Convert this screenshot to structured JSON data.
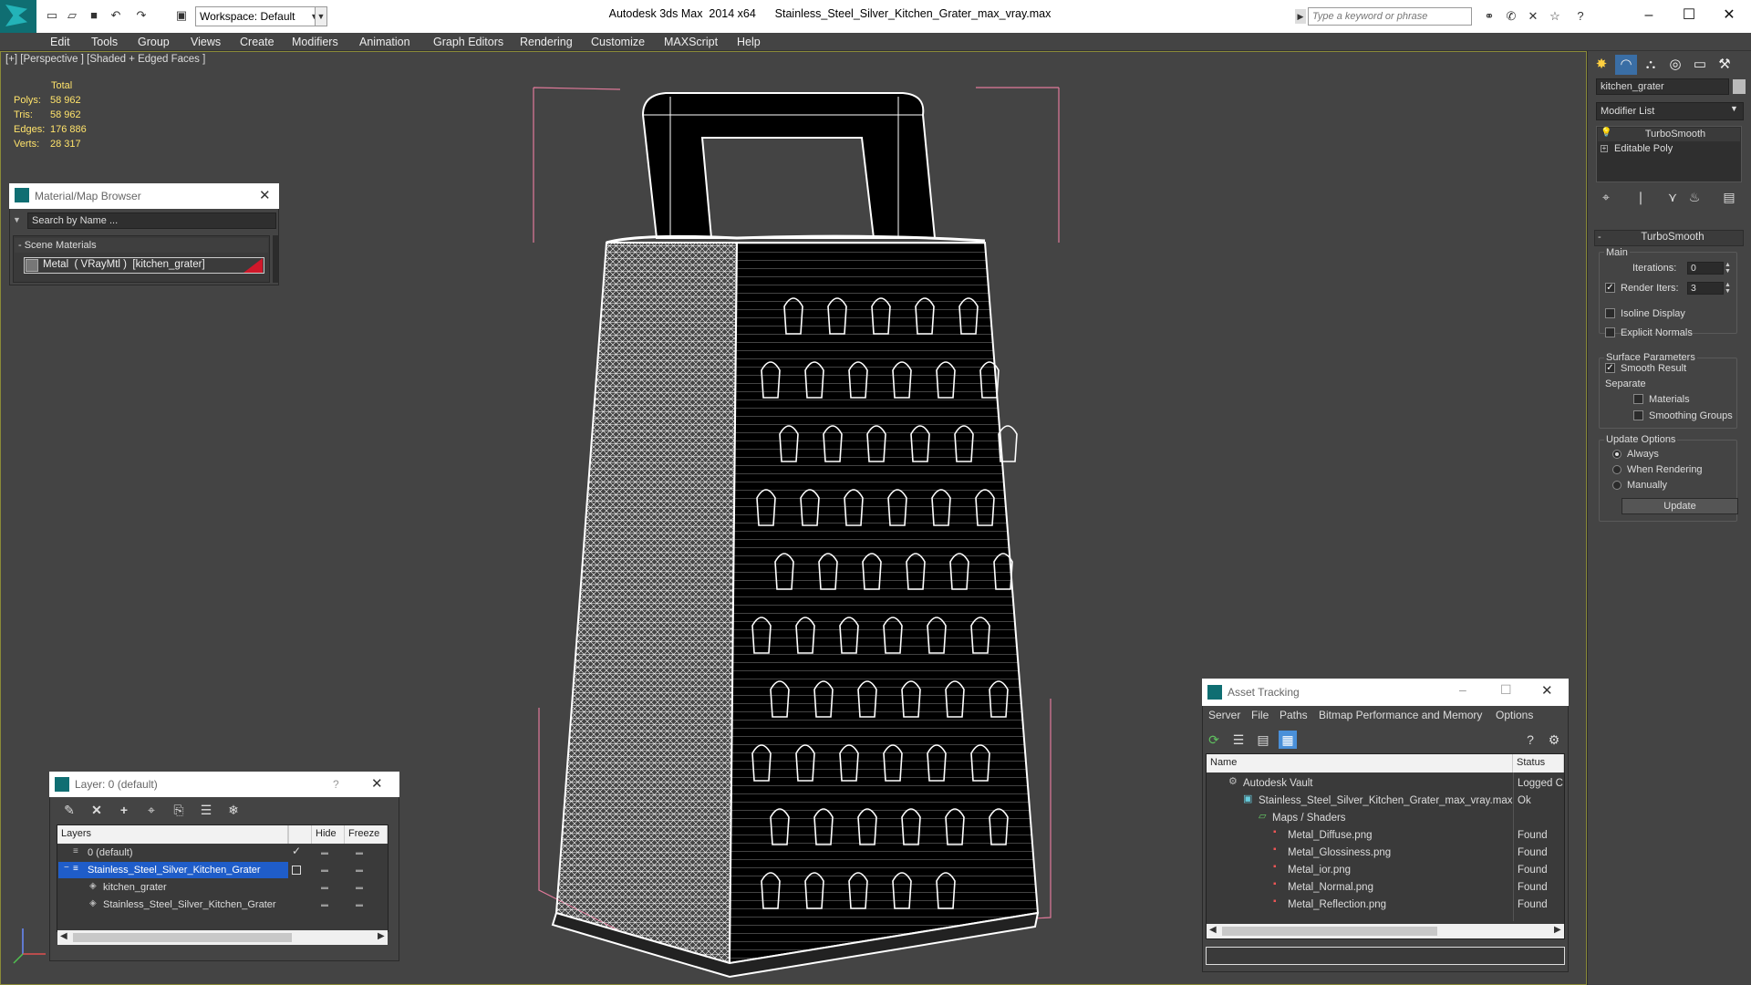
{
  "titlebar": {
    "workspace_label": "Workspace: Default",
    "app_title": "Autodesk 3ds Max  2014 x64      Stainless_Steel_Silver_Kitchen_Grater_max_vray.max",
    "search_placeholder": "Type a keyword or phrase"
  },
  "menu": [
    "Edit",
    "Tools",
    "Group",
    "Views",
    "Create",
    "Modifiers",
    "Animation",
    "Graph Editors",
    "Rendering",
    "Customize",
    "MAXScript",
    "Help"
  ],
  "viewport": {
    "label": "[+] [Perspective ] [Shaded + Edged Faces ]",
    "stats": {
      "total_label": "Total",
      "rows": [
        {
          "label": "Polys:",
          "value": "58 962"
        },
        {
          "label": "Tris:",
          "value": "58 962"
        },
        {
          "label": "Edges:",
          "value": "176 886"
        },
        {
          "label": "Verts:",
          "value": "28 317"
        }
      ]
    }
  },
  "material_browser": {
    "title": "Material/Map Browser",
    "search_placeholder": "Search by Name ...",
    "section": "- Scene Materials",
    "item": "Metal  ( VRayMtl )  [kitchen_grater]"
  },
  "layer_panel": {
    "title": "Layer: 0 (default)",
    "help": "?",
    "columns": {
      "layers": "Layers",
      "hide": "Hide",
      "freeze": "Freeze"
    },
    "rows": [
      {
        "name": "0 (default)"
      },
      {
        "name": "Stainless_Steel_Silver_Kitchen_Grater"
      },
      {
        "name": "kitchen_grater"
      },
      {
        "name": "Stainless_Steel_Silver_Kitchen_Grater"
      }
    ]
  },
  "asset_tracking": {
    "title": "Asset Tracking",
    "menu": [
      "Server",
      "File",
      "Paths",
      "Bitmap Performance and Memory",
      "Options"
    ],
    "columns": {
      "name": "Name",
      "status": "Status"
    },
    "rows": [
      {
        "name": "Autodesk Vault",
        "status": "Logged C"
      },
      {
        "name": "Stainless_Steel_Silver_Kitchen_Grater_max_vray.max",
        "status": "Ok"
      },
      {
        "name": "Maps / Shaders",
        "status": ""
      },
      {
        "name": "Metal_Diffuse.png",
        "status": "Found"
      },
      {
        "name": "Metal_Glossiness.png",
        "status": "Found"
      },
      {
        "name": "Metal_ior.png",
        "status": "Found"
      },
      {
        "name": "Metal_Normal.png",
        "status": "Found"
      },
      {
        "name": "Metal_Reflection.png",
        "status": "Found"
      }
    ]
  },
  "command_panel": {
    "object_name": "kitchen_grater",
    "modifier_list": "Modifier List",
    "stack": [
      "TurboSmooth",
      "Editable Poly"
    ],
    "rollout": "TurboSmooth",
    "main_label": "Main",
    "iterations_label": "Iterations:",
    "iterations_value": "0",
    "render_iters_label": "Render Iters:",
    "render_iters_value": "3",
    "isoline_label": "Isoline Display",
    "explicit_label": "Explicit Normals",
    "surface_label": "Surface Parameters",
    "smooth_label": "Smooth Result",
    "separate_label": "Separate",
    "materials_label": "Materials",
    "smoothing_groups_label": "Smoothing Groups",
    "update_options_label": "Update Options",
    "always_label": "Always",
    "when_rendering_label": "When Rendering",
    "manually_label": "Manually",
    "update_button": "Update"
  },
  "colors": {
    "selection": "#1f5dc9",
    "stat_text": "#ffe36b",
    "viewport_border": "#8a8a38",
    "material_swatch": "#d0182a"
  }
}
